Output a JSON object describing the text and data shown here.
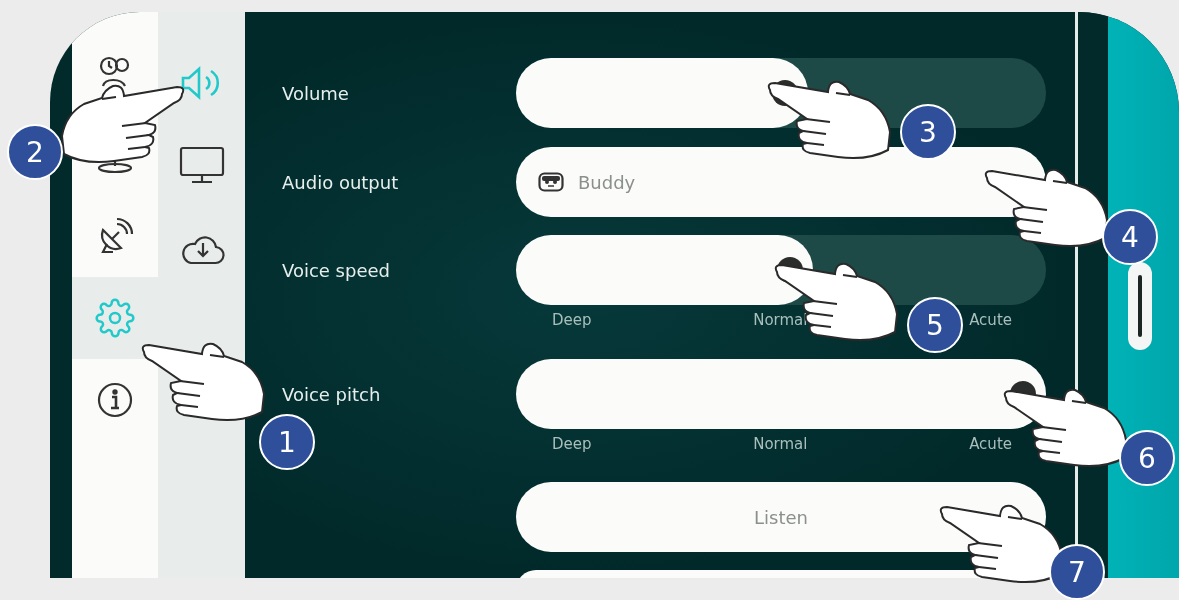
{
  "sidebar": {
    "primary": [
      {
        "kind": "map-person",
        "selected": false
      },
      {
        "kind": "robot",
        "selected": false
      },
      {
        "kind": "dish",
        "selected": false
      },
      {
        "kind": "gear",
        "selected": true
      },
      {
        "kind": "info",
        "selected": false
      }
    ],
    "secondary": [
      {
        "kind": "speaker",
        "selected": true
      },
      {
        "kind": "monitor",
        "selected": false
      },
      {
        "kind": "cloud",
        "selected": false
      }
    ]
  },
  "settings": [
    {
      "kind": "slider",
      "label": "Volume",
      "level": 0.55
    },
    {
      "kind": "select",
      "label": "Audio output",
      "value": "Buddy"
    },
    {
      "kind": "slider",
      "label": "Voice speed",
      "level": 0.56,
      "scale": [
        "Deep",
        "Normal",
        "Acute"
      ]
    },
    {
      "kind": "slider",
      "label": "Voice pitch",
      "level": 1.0,
      "scale": [
        "Deep",
        "Normal",
        "Acute"
      ]
    },
    {
      "kind": "button",
      "label": "Listen"
    },
    {
      "kind": "partial-button"
    }
  ],
  "callouts": [
    {
      "number": "1"
    },
    {
      "number": "2"
    },
    {
      "number": "3"
    },
    {
      "number": "4"
    },
    {
      "number": "5"
    },
    {
      "number": "6"
    },
    {
      "number": "7"
    }
  ]
}
